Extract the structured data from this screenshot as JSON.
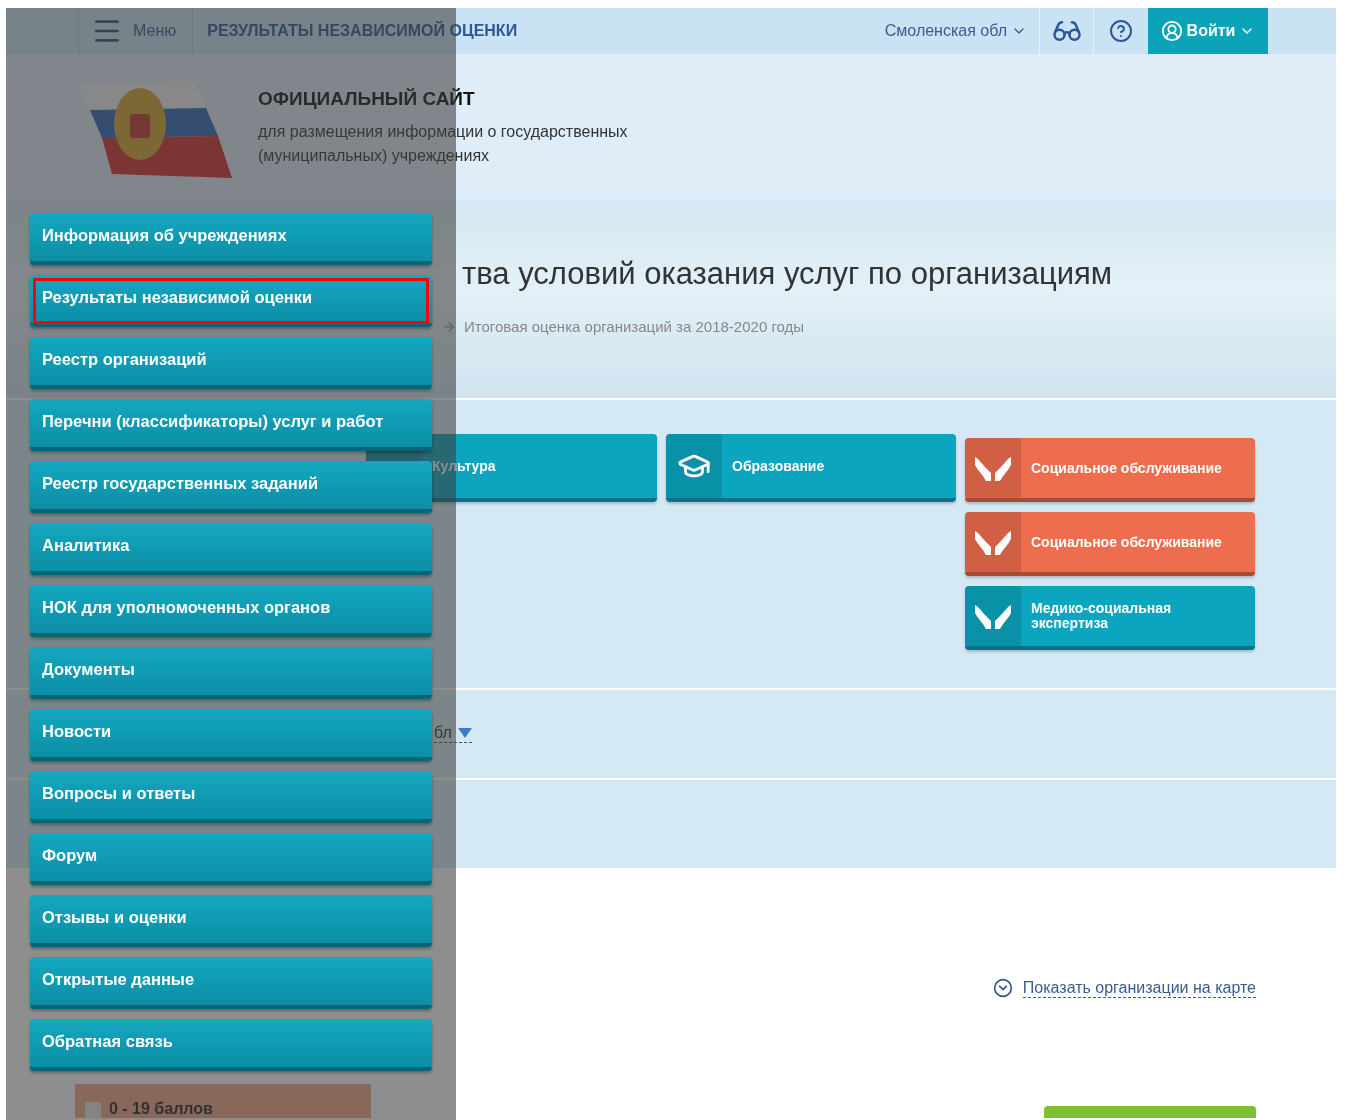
{
  "header": {
    "menu_label": "Меню",
    "section_title": "РЕЗУЛЬТАТЫ НЕЗАВИСИМОЙ ОЦЕНКИ",
    "region": "Смоленская обл",
    "login": "Войти"
  },
  "site": {
    "title": "ОФИЦИАЛЬНЫЙ САЙТ",
    "subtitle": "для размещения информации о государственных (муниципальных) учреждениях"
  },
  "hero": {
    "heading": "тва условий оказания услуг по организациям",
    "breadcrumb": "Итоговая оценка организаций за 2018-2020 годы"
  },
  "tile_columns": [
    {
      "tiles": [
        {
          "label": "Культура",
          "kind": "culture",
          "color": "#0ba5bf"
        }
      ]
    },
    {
      "tiles": [
        {
          "label": "Образование",
          "kind": "education",
          "color": "#0ba5bf"
        }
      ]
    },
    {
      "tiles": [
        {
          "label": "Социальное обслуживание",
          "kind": "social",
          "color": "#ee6d4e"
        },
        {
          "label": "Социальное обслуживание",
          "kind": "social",
          "color": "#ee6d4e"
        },
        {
          "label": "Медико-социальная экспертиза",
          "kind": "social",
          "color": "#0ba5bf"
        }
      ]
    }
  ],
  "filter": {
    "value": "бл"
  },
  "map_link": "Показать организации на карте",
  "legend": {
    "label": "0 - 19 баллов",
    "checked": false
  },
  "menu": {
    "items": [
      {
        "label": "Информация об учреждениях",
        "selected": false
      },
      {
        "label": "Результаты независимой оценки",
        "selected": true
      },
      {
        "label": "Реестр организаций",
        "selected": false
      },
      {
        "label": "Перечни (классификаторы) услуг и работ",
        "selected": false
      },
      {
        "label": "Реестр государственных заданий",
        "selected": false
      },
      {
        "label": "Аналитика",
        "selected": false
      },
      {
        "label": "НОК для уполномоченных органов",
        "selected": false
      },
      {
        "label": "Документы",
        "selected": false
      },
      {
        "label": "Новости",
        "selected": false
      },
      {
        "label": "Вопросы и ответы",
        "selected": false
      },
      {
        "label": "Форум",
        "selected": false
      },
      {
        "label": "Отзывы и оценки",
        "selected": false
      },
      {
        "label": "Открытые данные",
        "selected": false
      },
      {
        "label": "Обратная связь",
        "selected": false
      }
    ]
  }
}
